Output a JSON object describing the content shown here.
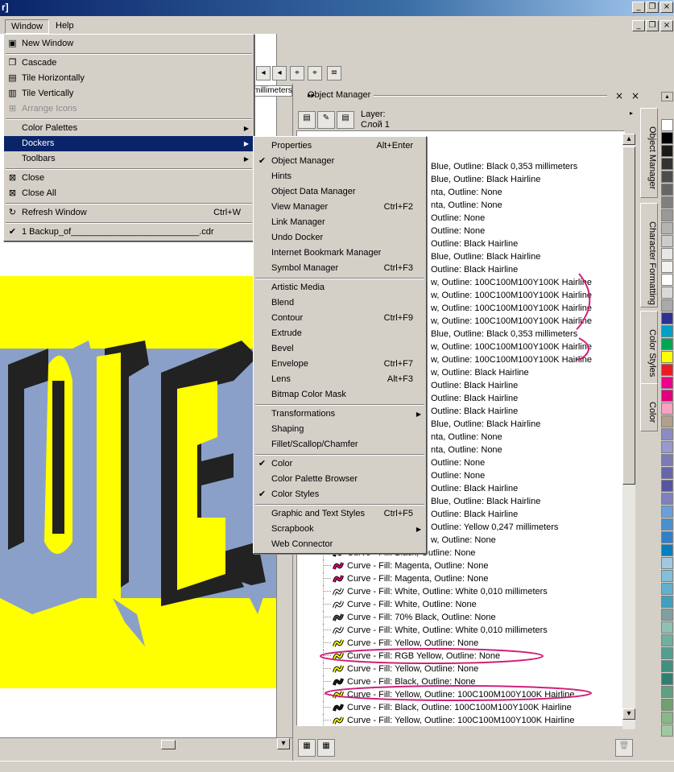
{
  "titlebar": {
    "title": "r]"
  },
  "menubar": {
    "items": [
      "Window",
      "Help"
    ]
  },
  "window_menu": [
    {
      "label": "New Window",
      "icon": "new-window-icon"
    },
    {
      "sep": true
    },
    {
      "label": "Cascade",
      "icon": "cascade-icon"
    },
    {
      "label": "Tile Horizontally",
      "icon": "tile-horizontal-icon"
    },
    {
      "label": "Tile Vertically",
      "icon": "tile-vertical-icon"
    },
    {
      "label": "Arrange Icons",
      "icon": "arrange-icons-icon",
      "disabled": true
    },
    {
      "sep": true
    },
    {
      "label": "Color Palettes",
      "submenu": true
    },
    {
      "label": "Dockers",
      "submenu": true,
      "selected": true
    },
    {
      "label": "Toolbars",
      "submenu": true
    },
    {
      "sep": true
    },
    {
      "label": "Close",
      "icon": "close-window-icon"
    },
    {
      "label": "Close All",
      "icon": "close-all-icon"
    },
    {
      "sep": true
    },
    {
      "label": "Refresh Window",
      "icon": "refresh-icon",
      "shortcut": "Ctrl+W"
    },
    {
      "sep": true
    },
    {
      "label": "1 Backup_of__________________________.cdr",
      "checked": true
    }
  ],
  "dockers_menu": [
    {
      "label": "Properties",
      "shortcut": "Alt+Enter"
    },
    {
      "label": "Object Manager",
      "checked": true
    },
    {
      "label": "Hints"
    },
    {
      "label": "Object Data Manager"
    },
    {
      "label": "View Manager",
      "shortcut": "Ctrl+F2"
    },
    {
      "label": "Link Manager"
    },
    {
      "label": "Undo Docker"
    },
    {
      "label": "Internet Bookmark Manager"
    },
    {
      "label": "Symbol Manager",
      "shortcut": "Ctrl+F3"
    },
    {
      "sep": true
    },
    {
      "label": "Artistic Media"
    },
    {
      "label": "Blend"
    },
    {
      "label": "Contour",
      "shortcut": "Ctrl+F9"
    },
    {
      "label": "Extrude"
    },
    {
      "label": "Bevel"
    },
    {
      "label": "Envelope",
      "shortcut": "Ctrl+F7"
    },
    {
      "label": "Lens",
      "shortcut": "Alt+F3"
    },
    {
      "label": "Bitmap Color Mask"
    },
    {
      "sep": true
    },
    {
      "label": "Transformations",
      "submenu": true
    },
    {
      "label": "Shaping"
    },
    {
      "label": "Fillet/Scallop/Chamfer"
    },
    {
      "sep": true
    },
    {
      "label": "Color",
      "checked": true
    },
    {
      "label": "Color Palette Browser"
    },
    {
      "label": "Color Styles",
      "checked": true
    },
    {
      "sep": true
    },
    {
      "label": "Graphic and Text Styles",
      "shortcut": "Ctrl+F5"
    },
    {
      "label": "Scrapbook",
      "submenu": true
    },
    {
      "label": "Web Connector"
    }
  ],
  "ruler_label": "millimeters",
  "docker": {
    "title": "Object Manager",
    "layer_label": "Layer:",
    "layer_name": "Слой 1"
  },
  "tree_rows_right": [
    "Blue, Outline: Black  0,353 millimeters",
    "Blue, Outline: Black  Hairline",
    "nta, Outline: None",
    "nta, Outline: None",
    "Outline: None",
    "Outline: None",
    "Outline: Black  Hairline",
    "Blue, Outline: Black  Hairline",
    "Outline: Black  Hairline",
    "w, Outline: 100C100M100Y100K  Hairline",
    "w, Outline: 100C100M100Y100K  Hairline",
    "w, Outline: 100C100M100Y100K  Hairline",
    "w, Outline: 100C100M100Y100K  Hairline",
    "Blue, Outline: Black  0,353 millimeters",
    "w, Outline: 100C100M100Y100K  Hairline",
    "w, Outline: 100C100M100Y100K  Hairline",
    "w, Outline: Black  Hairline",
    "Outline: Black  Hairline",
    "Outline: Black  Hairline",
    "Outline: Black  Hairline",
    "Blue, Outline: Black  Hairline",
    "nta, Outline: None",
    "nta, Outline: None",
    "Outline: None",
    "Outline: None",
    "Outline: Black  Hairline",
    "Blue, Outline: Black  Hairline",
    "Outline: Black  Hairline",
    "Outline: Yellow  0,247 millimeters",
    "w, Outline: None"
  ],
  "tree_rows_full": [
    {
      "text": "Curve - Fill: Black, Outline: None",
      "color": "#1a1a1a"
    },
    {
      "text": "Curve - Fill: Magenta, Outline: None",
      "color": "#e0007a"
    },
    {
      "text": "Curve - Fill: Magenta, Outline: None",
      "color": "#e0007a"
    },
    {
      "text": "Curve - Fill: White, Outline: White  0,010 millimeters",
      "color": "#ffffff"
    },
    {
      "text": "Curve - Fill: White, Outline: None",
      "color": "#ffffff"
    },
    {
      "text": "Curve - Fill: 70% Black, Outline: None",
      "color": "#4d4d4d"
    },
    {
      "text": "Curve - Fill: White, Outline: White  0,010 millimeters",
      "color": "#ffffff"
    },
    {
      "text": "Curve - Fill: Yellow, Outline: None",
      "color": "#ffff00"
    },
    {
      "text": "Curve - Fill: RGB Yellow, Outline: None",
      "color": "#ffff00"
    },
    {
      "text": "Curve - Fill: Yellow, Outline: None",
      "color": "#ffff00"
    },
    {
      "text": "Curve - Fill: Black, Outline: None",
      "color": "#1a1a1a"
    },
    {
      "text": "Curve - Fill: Yellow, Outline: 100C100M100Y100K  Hairline",
      "color": "#ffff00"
    },
    {
      "text": "Curve - Fill: Black, Outline: 100C100M100Y100K  Hairline",
      "color": "#1a1a1a"
    },
    {
      "text": "Curve - Fill: Yellow, Outline: 100C100M100Y100K  Hairline",
      "color": "#ffff00"
    }
  ],
  "side_tabs": [
    "Object Manager",
    "Character Formatting",
    "Color Styles",
    "Color"
  ],
  "palette_colors": [
    "#ffffff",
    "#000000",
    "#1a1a1a",
    "#333333",
    "#4d4d4d",
    "#666666",
    "#808080",
    "#999999",
    "#b3b3b3",
    "#cccccc",
    "#e6e6e6",
    "#f2f2f2",
    "#ffffff",
    "#d9d9d9",
    "#aaaaaa",
    "#2e3192",
    "#00a0c6",
    "#00a651",
    "#ffff00",
    "#ed1c24",
    "#ec008c",
    "#e4007c",
    "#f9a1c0",
    "#b0a090",
    "#8b8bc5",
    "#9999cc",
    "#7b7bb5",
    "#6666aa",
    "#5555a0",
    "#8080c0",
    "#6aa0d8",
    "#4a90d0",
    "#3080c8",
    "#0080c0",
    "#a0c8e0",
    "#80c0d8",
    "#60b0d0",
    "#40a0c0",
    "#80a0a0",
    "#90c0b0",
    "#70b0a0",
    "#50a090",
    "#409080",
    "#308070",
    "#60a080",
    "#70a070",
    "#88b888",
    "#a0c8a0"
  ]
}
